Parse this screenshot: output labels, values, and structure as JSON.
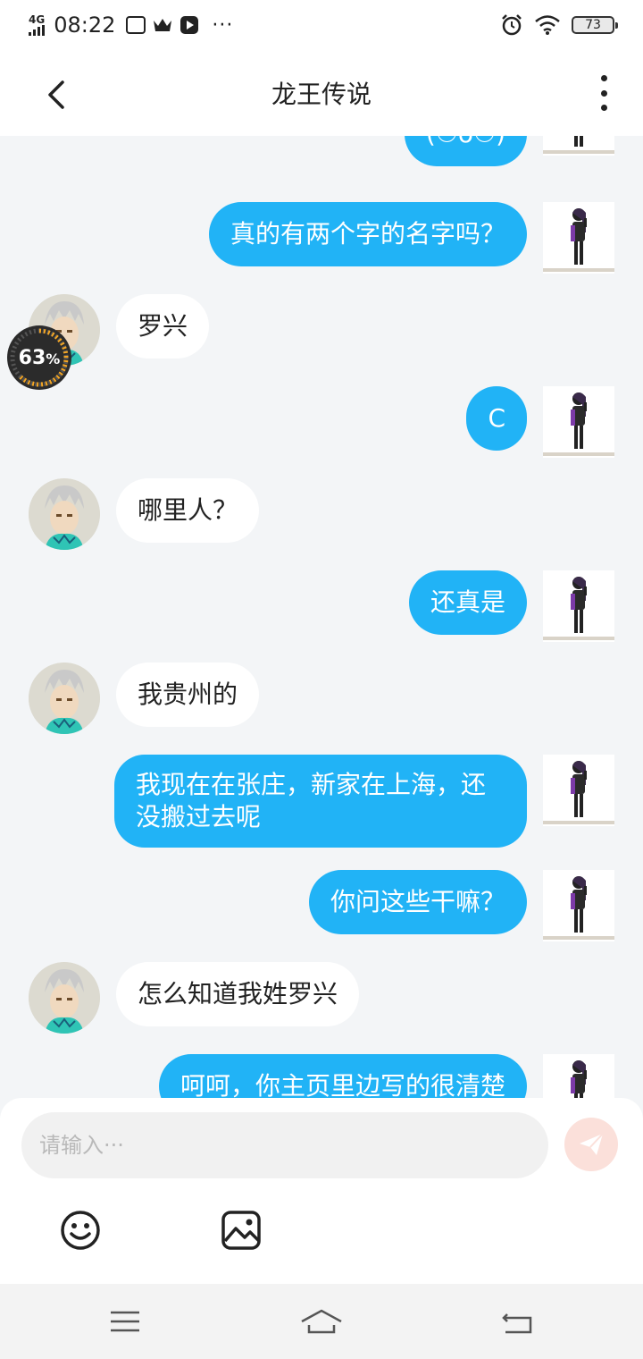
{
  "status_bar": {
    "network": "4G",
    "time": "08:22",
    "dots": "···",
    "battery": "73"
  },
  "header": {
    "title": "龙王传说"
  },
  "messages": [
    {
      "side": "out",
      "text": "(☉o☉)"
    },
    {
      "side": "out",
      "text": "真的有两个字的名字吗？"
    },
    {
      "side": "in",
      "text": "罗兴"
    },
    {
      "side": "out",
      "text": "C"
    },
    {
      "side": "in",
      "text": "哪里人？"
    },
    {
      "side": "out",
      "text": "还真是"
    },
    {
      "side": "in",
      "text": "我贵州的"
    },
    {
      "side": "out",
      "text": "我现在在张庄，新家在上海，还没搬过去呢"
    },
    {
      "side": "out",
      "text": "你问这些干嘛？"
    },
    {
      "side": "in",
      "text": "怎么知道我姓罗兴"
    },
    {
      "side": "out",
      "text": "呵呵，你主页里边写的很清楚"
    }
  ],
  "progress_badge": {
    "value": "63",
    "unit": "%",
    "fraction": 0.63
  },
  "composer": {
    "placeholder": "请输入···",
    "send_icon": "paper-plane-icon",
    "tools": [
      "smiley-icon",
      "image-icon"
    ]
  },
  "system_nav": [
    "menu-icon",
    "home-icon",
    "back-icon"
  ],
  "colors": {
    "accent": "#21b3f6",
    "send_disabled": "#fbe0da",
    "background": "#f3f5f7"
  }
}
